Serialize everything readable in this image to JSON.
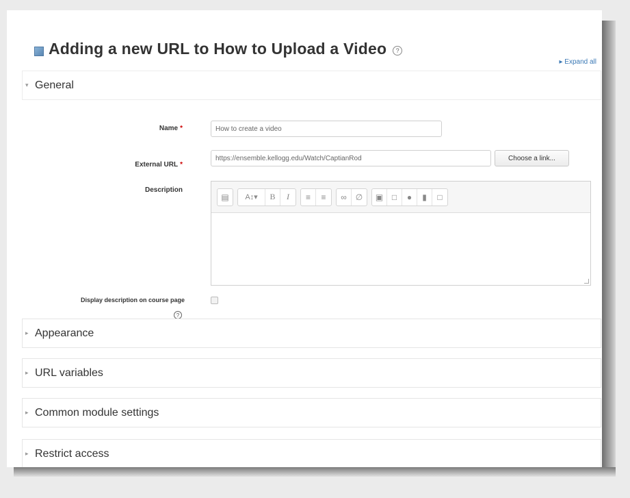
{
  "page": {
    "title": "Adding a new URL to How to Upload a Video",
    "expand_all": "Expand all"
  },
  "sections": {
    "general": "General",
    "appearance": "Appearance",
    "url_variables": "URL variables",
    "common_module_settings": "Common module settings",
    "restrict_access": "Restrict access"
  },
  "form": {
    "name_label": "Name",
    "name_value": "How to create a video",
    "external_url_label": "External URL",
    "external_url_value": "https://ensemble.kellogg.edu/Watch/CaptianRod",
    "choose_link_button": "Choose a link...",
    "description_label": "Description",
    "display_description_label": "Display description on course page",
    "required_marker": "*"
  },
  "toolbar": {
    "icons": [
      "collapse-icon",
      "text-style-icon",
      "bold-icon",
      "italic-icon",
      "unordered-list-icon",
      "ordered-list-icon",
      "link-icon",
      "unlink-icon",
      "image-icon",
      "media-icon",
      "record-audio-icon",
      "record-video-icon",
      "manage-files-icon"
    ],
    "bold": "B",
    "italic": "I",
    "text_style": "A↕▾"
  },
  "colors": {
    "required": "#cc0000",
    "link": "#3a78b5"
  }
}
